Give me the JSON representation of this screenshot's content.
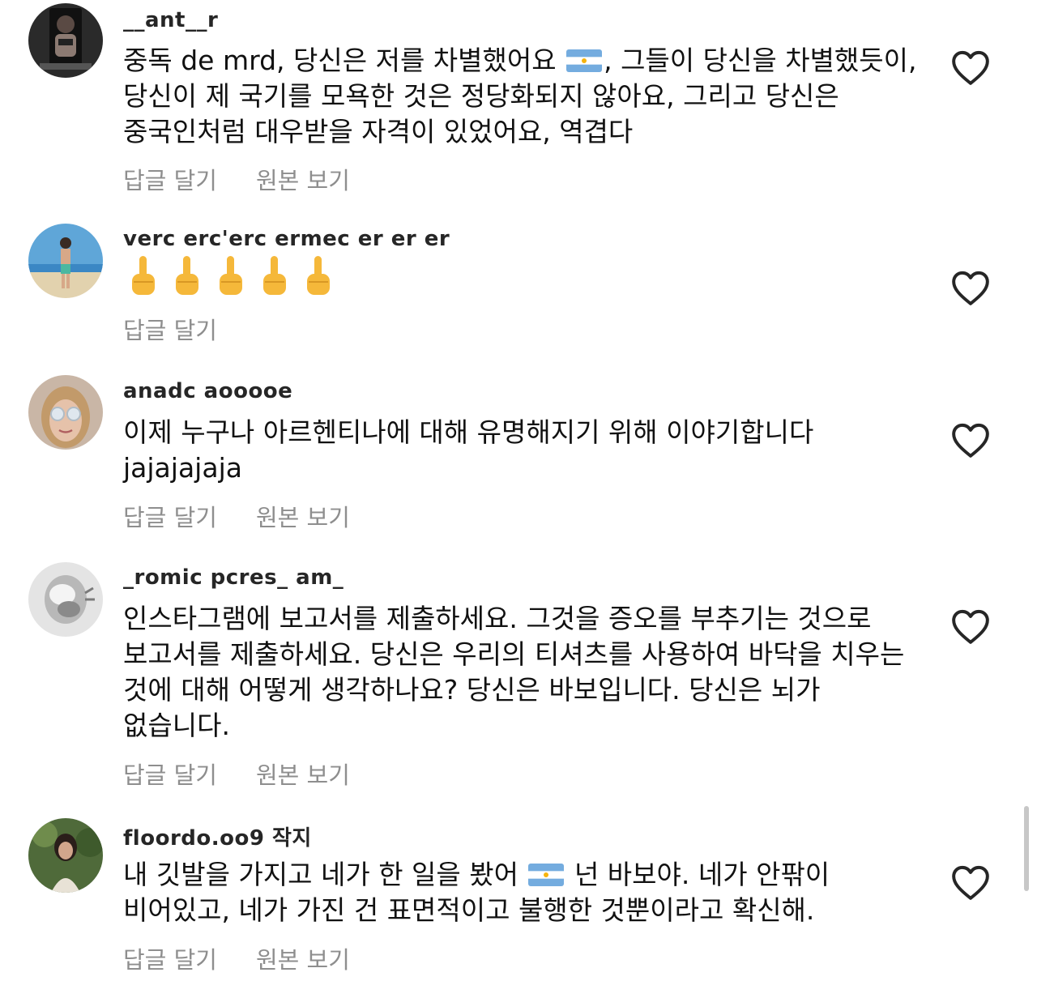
{
  "comments": [
    {
      "username": "__ant__r",
      "text_before_flag": "중독 de mrd, 당신은 저를 차별했어요 ",
      "text_after_flag": ", 그들이 당신을 차별했듯이, 당신이 제 국기를 모욕한 것은 정당화되지 않아요, 그리고 당신은 중국인처럼 대우받을 자격이 있었어요, 역겹다",
      "reply_label": "답글 달기",
      "translate_label": "원본 보기"
    },
    {
      "username": "verc erc'erc ermec  er  er er",
      "emoji": "🖕🖕🖕🖕🖕",
      "reply_label": "답글 달기"
    },
    {
      "username": "anadc aooooe",
      "text": "이제 누구나 아르헨티나에 대해 유명해지기 위해 이야기합니다 jajajajaja",
      "reply_label": "답글 달기",
      "translate_label": "원본 보기"
    },
    {
      "username": "_romic pcres_ am_",
      "text": "인스타그램에 보고서를 제출하세요. 그것을 증오를 부추기는 것으로 보고서를 제출하세요. 당신은 우리의 티셔츠를 사용하여 바닥을 치우는 것에 대해 어떻게 생각하나요? 당신은 바보입니다. 당신은 뇌가 없습니다.",
      "reply_label": "답글 달기",
      "translate_label": "원본 보기"
    },
    {
      "username": "floordo.oo9 작지",
      "text_before_flag": "내 깃발을 가지고 네가 한 일을 봤어 ",
      "text_after_flag": " 넌 바보야. 네가 안팎이 비어있고, 네가 가진 건 표면적이고 불행한 것뿐이라고 확신해.",
      "reply_label": "답글 달기",
      "translate_label": "원본 보기"
    }
  ],
  "colors": {
    "text": "#111111",
    "muted": "#8e8e8e",
    "flag_blue": "#74acdf",
    "flag_sun": "#f6b40e"
  },
  "icons": [
    "heart-icon",
    "argentina-flag-icon",
    "middle-finger-emoji"
  ]
}
